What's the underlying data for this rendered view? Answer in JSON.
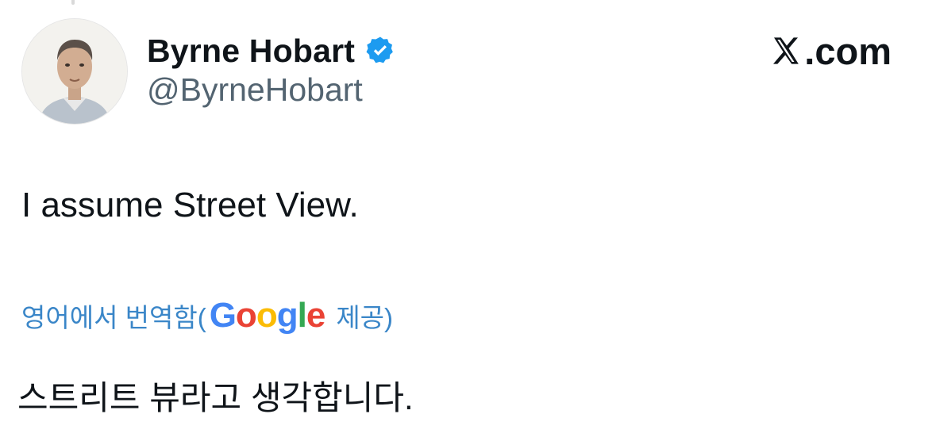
{
  "author": {
    "display_name": "Byrne Hobart",
    "handle": "@ByrneHobart",
    "verified": true
  },
  "brand": {
    "text": ".com",
    "logo_icon": "x-logo-icon"
  },
  "tweet": {
    "text": "I assume Street View."
  },
  "translation": {
    "prefix": "영어에서 번역함(",
    "google_letters": [
      "G",
      "o",
      "o",
      "g",
      "l",
      "e"
    ],
    "suffix": "제공)",
    "translated_text": "스트리트 뷰라고 생각합니다."
  },
  "colors": {
    "text": "#0f1419",
    "secondary": "#536471",
    "verified_blue": "#1d9bf0",
    "translation_link": "#3a86c8",
    "google_blue": "#4285F4",
    "google_red": "#EA4335",
    "google_yellow": "#FBBC05",
    "google_green": "#34A853"
  }
}
